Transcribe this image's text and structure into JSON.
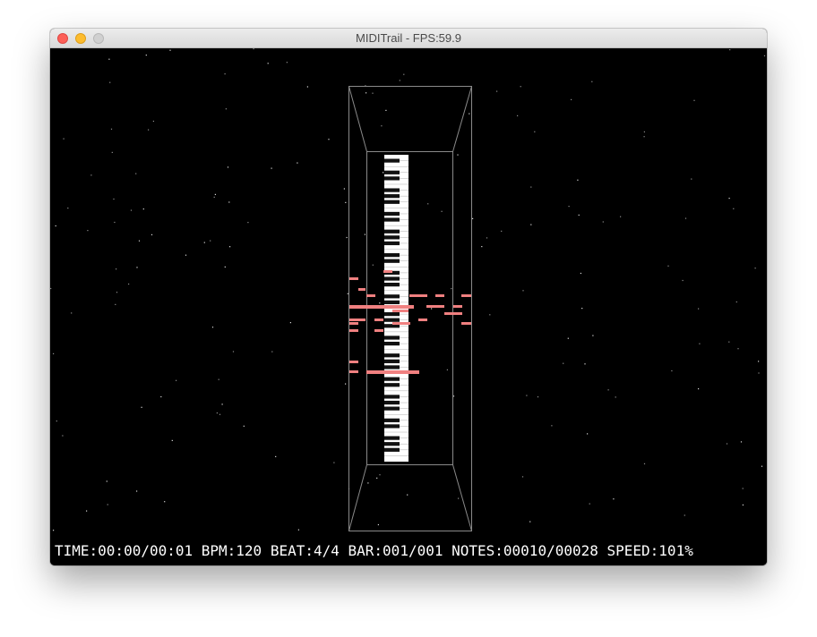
{
  "window": {
    "title": "MIDITrail - FPS:59.9",
    "controls": [
      "close-button",
      "minimize-button",
      "zoom-button"
    ]
  },
  "colors": {
    "background": "#000000",
    "frame": "#8a8a8a",
    "note": "#f08080",
    "status_text": "#ffffff"
  },
  "status_bar": {
    "text": "TIME:00:00/00:01 BPM:120 BEAT:4/4 BAR:001/001 NOTES:00010/00028 SPEED:101%"
  }
}
